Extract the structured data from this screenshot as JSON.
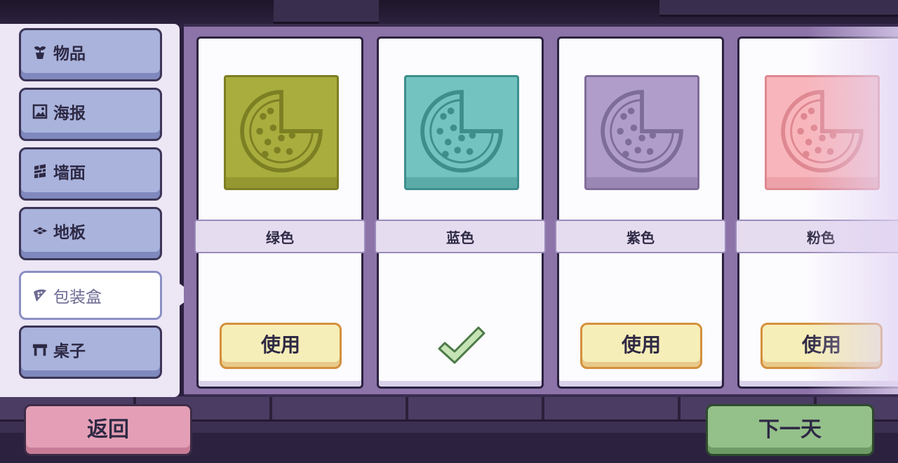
{
  "sidebar": {
    "categories": [
      {
        "label": "物品",
        "icon": "plant-pot-icon",
        "active": false
      },
      {
        "label": "海报",
        "icon": "picture-frame-icon",
        "active": false
      },
      {
        "label": "墙面",
        "icon": "wall-brick-icon",
        "active": false
      },
      {
        "label": "地板",
        "icon": "floor-tile-icon",
        "active": false
      },
      {
        "label": "包装盒",
        "icon": "pizza-slice-icon",
        "active": true
      },
      {
        "label": "桌子",
        "icon": "table-icon",
        "active": false
      }
    ]
  },
  "cards": [
    {
      "name": "绿色",
      "color": "#a9ad3e",
      "dark": "#7c7f22",
      "state": "available",
      "action_label": "使用"
    },
    {
      "name": "蓝色",
      "color": "#73c3c0",
      "dark": "#3d8f8c",
      "state": "equipped",
      "action_label": ""
    },
    {
      "name": "紫色",
      "color": "#b19dc9",
      "dark": "#7f6d99",
      "state": "available",
      "action_label": "使用"
    },
    {
      "name": "粉色",
      "color": "#f8b6bc",
      "dark": "#df8891",
      "state": "available",
      "action_label": "使用"
    }
  ],
  "footer": {
    "back_label": "返回",
    "next_label": "下一天"
  },
  "colors": {
    "sidebar_bg": "#ece6f5",
    "category_button": "#a9b3dc",
    "panel_bg": "#8c73a8",
    "back_button": "#e49fb6",
    "next_button": "#94c08a",
    "use_button": "#f6eeb8"
  }
}
